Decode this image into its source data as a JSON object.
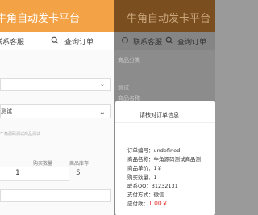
{
  "header": {
    "title": "牛角自动发卡平台",
    "title_dim": "牛角自动发卡平台"
  },
  "nav": {
    "service_label": "联系客服",
    "query_label": "查询订单",
    "service_label_dim": "联系客服",
    "query_label_dim": "查询订单"
  },
  "form": {
    "category_value": "测试",
    "product_value": "测试",
    "hint": "牛角源码测试商品测试",
    "buy_qty_label": "购买数量",
    "stock_label": "商品库存",
    "buy_qty_value": "1",
    "stock_value": "5",
    "dim_labels": {
      "category": "商品分类",
      "category_value": "测试",
      "product": "商品名称",
      "product_value": "测试"
    }
  },
  "modal": {
    "title": "请核对订单信息",
    "rows": {
      "order_no": "订单编号：undefined",
      "product_name": "商品名称：牛角源码测试商品测",
      "unit_price": "商品单价：1￥",
      "buy_qty": "购买数量：1",
      "contact_qq": "联系QQ：31232131",
      "pay_method": "支付方式：微信",
      "amount_label": "应付款：",
      "amount_value": "1.00￥"
    }
  },
  "colors": {
    "header": "#f3a246",
    "accent_red": "#e03030"
  }
}
